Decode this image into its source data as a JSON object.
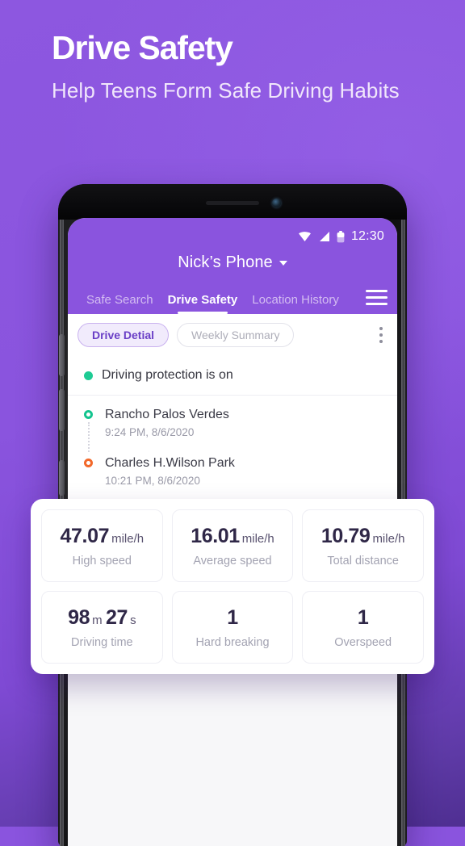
{
  "hero": {
    "title": "Drive Safety",
    "subtitle": "Help Teens Form Safe Driving Habits"
  },
  "colors": {
    "brand_purple": "#8a54de",
    "backdrop_bottom": "#4f2f92",
    "chip_active_text": "#6a3fc6",
    "chip_active_bg": "#f1ebfc",
    "status_on_green": "#1ecb94",
    "marker_start_green": "#14c48f",
    "marker_end_orange": "#f2682a",
    "stat_value": "#2f2747",
    "stat_label": "#a3a3b2"
  },
  "phone": {
    "statusbar": {
      "wifi_icon": "wifi-icon",
      "signal_icon": "cellular-signal-icon",
      "battery_icon": "battery-icon",
      "clock": "12:30"
    },
    "device_selector": {
      "name": "Nick’s Phone",
      "caret_icon": "chevron-down-icon"
    },
    "tabs": [
      {
        "label": "Safe Search",
        "active": false
      },
      {
        "label": "Drive Safety",
        "active": true
      },
      {
        "label": "Location History",
        "active": false
      }
    ],
    "menu_icon": "hamburger-menu-icon",
    "chips": [
      {
        "label": "Drive Detial",
        "active": true
      },
      {
        "label": "Weekly Summary",
        "active": false
      }
    ],
    "overflow_icon": "kebab-menu-icon",
    "protection": {
      "status_text": "Driving protection is on"
    },
    "timeline": [
      {
        "name": "Rancho Palos Verdes",
        "time": "9:24 PM, 8/6/2020",
        "marker": "start-marker-icon"
      },
      {
        "name": "Charles H.Wilson Park",
        "time": "10:21 PM, 8/6/2020",
        "marker": "end-marker-icon"
      }
    ]
  },
  "stats": [
    {
      "value": "47.07",
      "unit": "mile/h",
      "label": "High speed"
    },
    {
      "value": "16.01",
      "unit": "mile/h",
      "label": "Average speed"
    },
    {
      "value": "10.79",
      "unit": "mile/h",
      "label": "Total distance"
    },
    {
      "value": "98",
      "unit": "m",
      "value2": "27",
      "unit2": "s",
      "label": "Driving time"
    },
    {
      "value": "1",
      "unit": "",
      "label": "Hard breaking"
    },
    {
      "value": "1",
      "unit": "",
      "label": "Overspeed"
    }
  ]
}
